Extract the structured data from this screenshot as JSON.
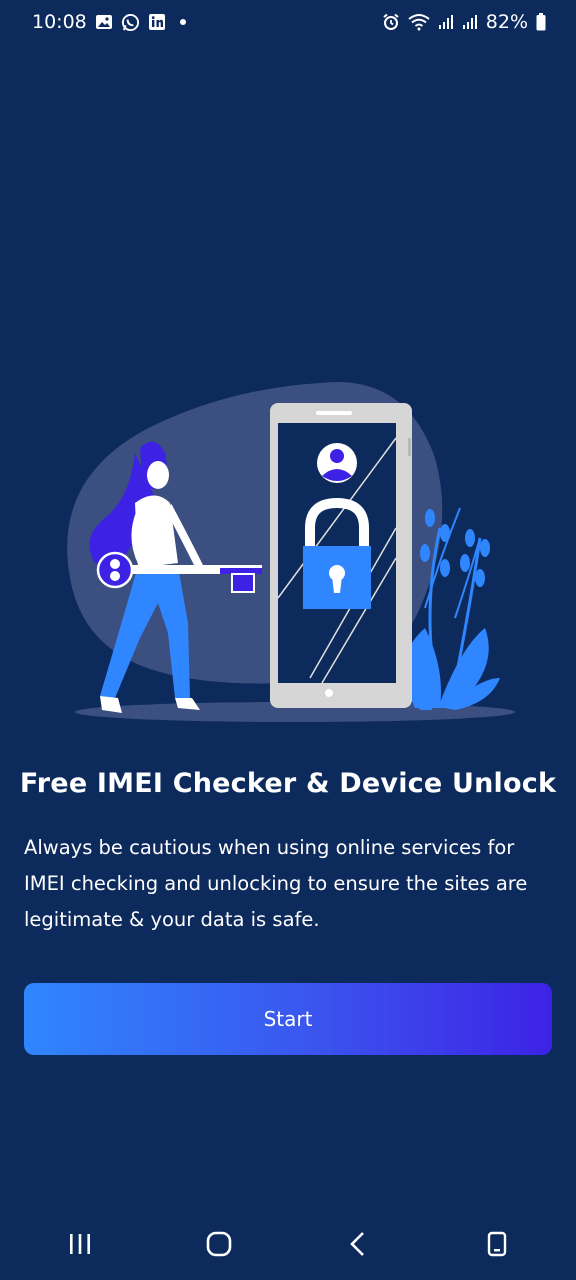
{
  "status_bar": {
    "time": "10:08",
    "battery": "82%",
    "left_icons": [
      "gallery-icon",
      "whatsapp-icon",
      "linkedin-icon",
      "dot-icon"
    ],
    "right_icons": [
      "alarm-icon",
      "wifi-icon",
      "signal-icon",
      "signal-icon",
      "battery-icon"
    ]
  },
  "main": {
    "title": "Free IMEI Checker & Device Unlock",
    "body": "Always be cautious when using online services for IMEI checking and unlocking to ensure the sites are legitimate & your data is safe.",
    "start_label": "Start"
  },
  "nav_bar": {
    "buttons": [
      "recents-icon",
      "home-icon",
      "back-icon",
      "screenshot-icon"
    ]
  },
  "colors": {
    "background": "#0d2a5c",
    "accent_blue": "#2f86ff",
    "accent_purple": "#3d22e6"
  }
}
